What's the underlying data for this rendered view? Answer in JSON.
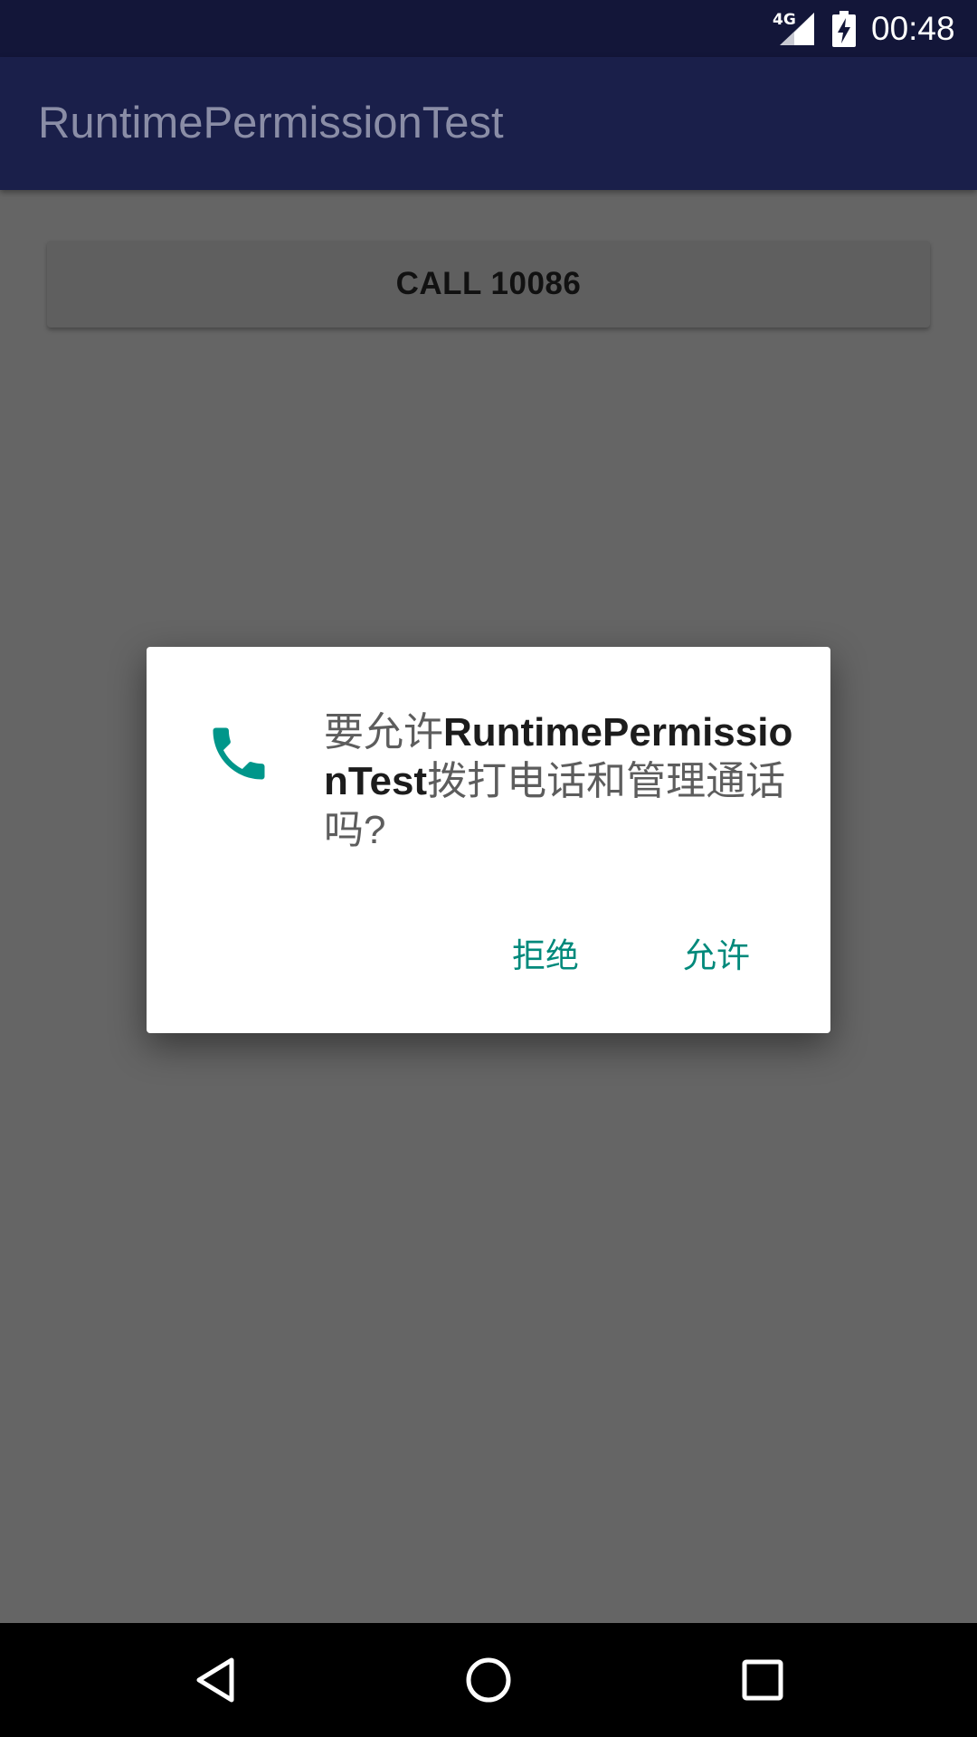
{
  "status_bar": {
    "network": "4G",
    "time": "00:48",
    "icons": [
      "signal-icon",
      "battery-charging-icon"
    ]
  },
  "app_bar": {
    "title": "RuntimePermissionTest"
  },
  "main": {
    "call_button_label": "CALL 10086"
  },
  "dialog": {
    "icon": "phone-icon",
    "message_prefix": "要允许",
    "app_name": "RuntimePermissionTest",
    "message_suffix": "拨打电话和管理通话吗?",
    "deny_label": "拒绝",
    "allow_label": "允许"
  },
  "nav_bar": {
    "icons": [
      "back-icon",
      "home-icon",
      "recents-icon"
    ]
  },
  "colors": {
    "status_bar": "#131639",
    "app_bar": "#1a1f4a",
    "scrim_background": "#656565",
    "accent": "#00897b",
    "dialog_background": "#ffffff"
  }
}
